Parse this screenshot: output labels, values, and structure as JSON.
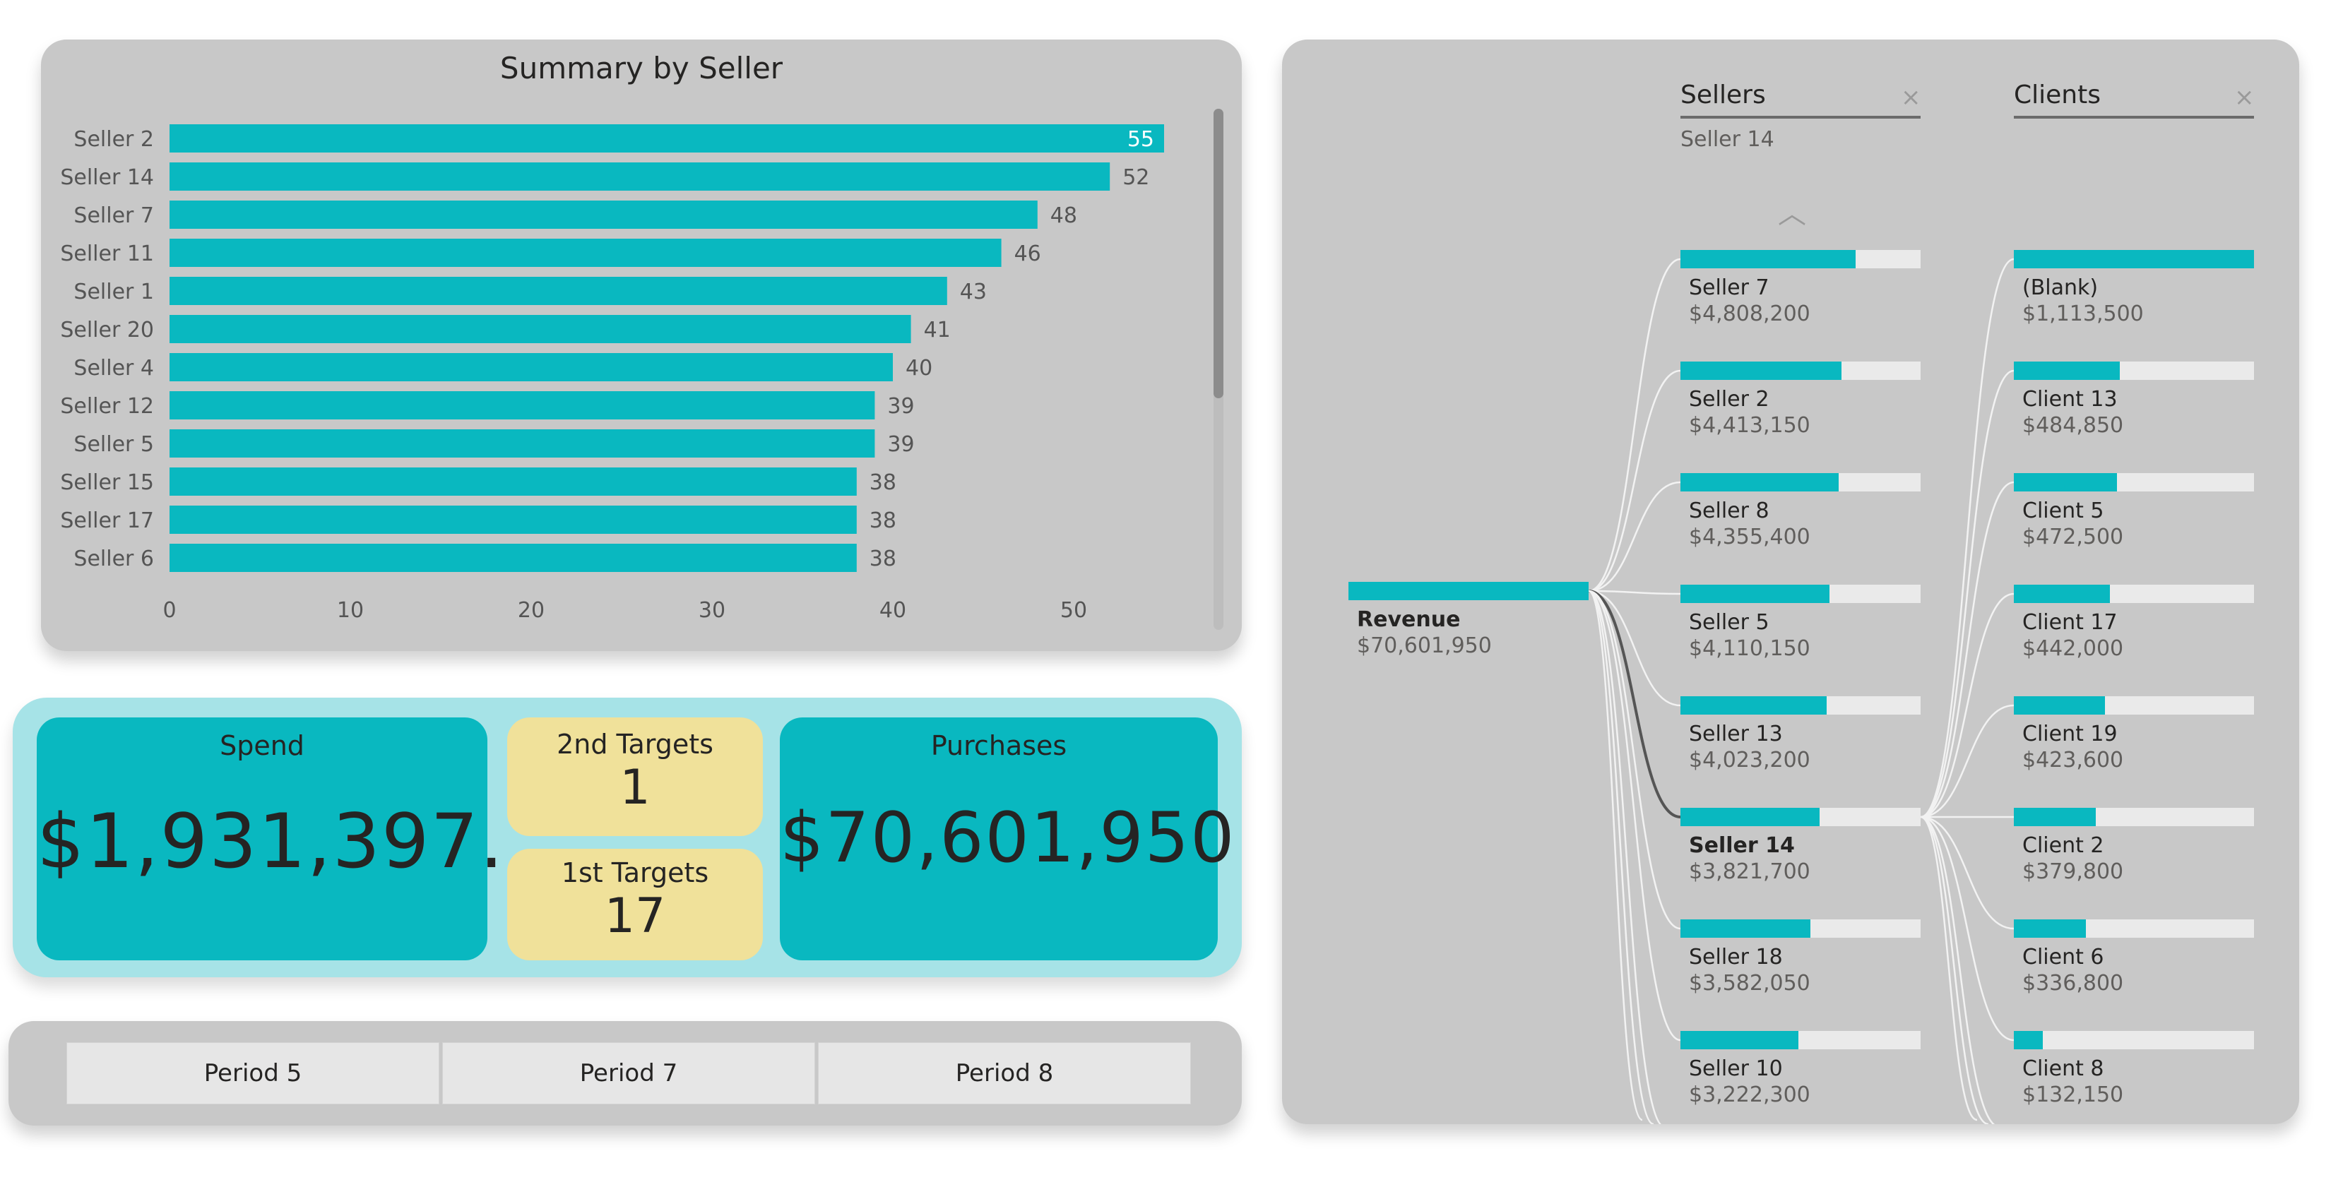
{
  "bar_chart": {
    "title": "Summary by Seller",
    "chart_data": {
      "type": "bar",
      "orientation": "horizontal",
      "title": "Summary by Seller",
      "categories": [
        "Seller 2",
        "Seller 14",
        "Seller 7",
        "Seller 11",
        "Seller 1",
        "Seller 20",
        "Seller 4",
        "Seller 12",
        "Seller 5",
        "Seller 15",
        "Seller 17",
        "Seller 6"
      ],
      "values": [
        55,
        52,
        48,
        46,
        43,
        41,
        40,
        39,
        39,
        38,
        38,
        38
      ],
      "xlim": [
        0,
        60
      ],
      "xticks": [
        0,
        10,
        20,
        30,
        40,
        50
      ],
      "data_labels": true,
      "grid": false,
      "bar_color": "#09b8c0"
    }
  },
  "kpis": {
    "spend_label": "Spend",
    "spend_value": "$1,931,397....",
    "second_targets_label": "2nd Targets",
    "second_targets_value": "1",
    "first_targets_label": "1st Targets",
    "first_targets_value": "17",
    "purchases_label": "Purchases",
    "purchases_value": "$70,601,950"
  },
  "slicer": {
    "periods": [
      "Period 5",
      "Period 7",
      "Period 8"
    ]
  },
  "decomposition_tree": {
    "root": {
      "label": "Revenue",
      "value": "$70,601,950"
    },
    "sellers_column": {
      "header": "Sellers",
      "close": "×",
      "selection": "Seller 14",
      "scroll_up": "︿",
      "nodes": [
        {
          "name": "Seller 7",
          "value": "$4,808,200",
          "fill": 0.73
        },
        {
          "name": "Seller 2",
          "value": "$4,413,150",
          "fill": 0.67
        },
        {
          "name": "Seller 8",
          "value": "$4,355,400",
          "fill": 0.66
        },
        {
          "name": "Seller 5",
          "value": "$4,110,150",
          "fill": 0.62
        },
        {
          "name": "Seller 13",
          "value": "$4,023,200",
          "fill": 0.61
        },
        {
          "name": "Seller 14",
          "value": "$3,821,700",
          "fill": 0.58,
          "selected": true
        },
        {
          "name": "Seller 18",
          "value": "$3,582,050",
          "fill": 0.54
        },
        {
          "name": "Seller 10",
          "value": "$3,222,300",
          "fill": 0.49
        }
      ]
    },
    "clients_column": {
      "header": "Clients",
      "close": "×",
      "nodes": [
        {
          "name": "(Blank)",
          "value": "$1,113,500",
          "fill": 1.0
        },
        {
          "name": "Client 13",
          "value": "$484,850",
          "fill": 0.44
        },
        {
          "name": "Client 5",
          "value": "$472,500",
          "fill": 0.43
        },
        {
          "name": "Client 17",
          "value": "$442,000",
          "fill": 0.4
        },
        {
          "name": "Client 19",
          "value": "$423,600",
          "fill": 0.38
        },
        {
          "name": "Client 2",
          "value": "$379,800",
          "fill": 0.34
        },
        {
          "name": "Client 6",
          "value": "$336,800",
          "fill": 0.3
        },
        {
          "name": "Client 8",
          "value": "$132,150",
          "fill": 0.12
        }
      ]
    },
    "colors": {
      "accent": "#09b8c0",
      "track": "#eaeaea"
    }
  }
}
